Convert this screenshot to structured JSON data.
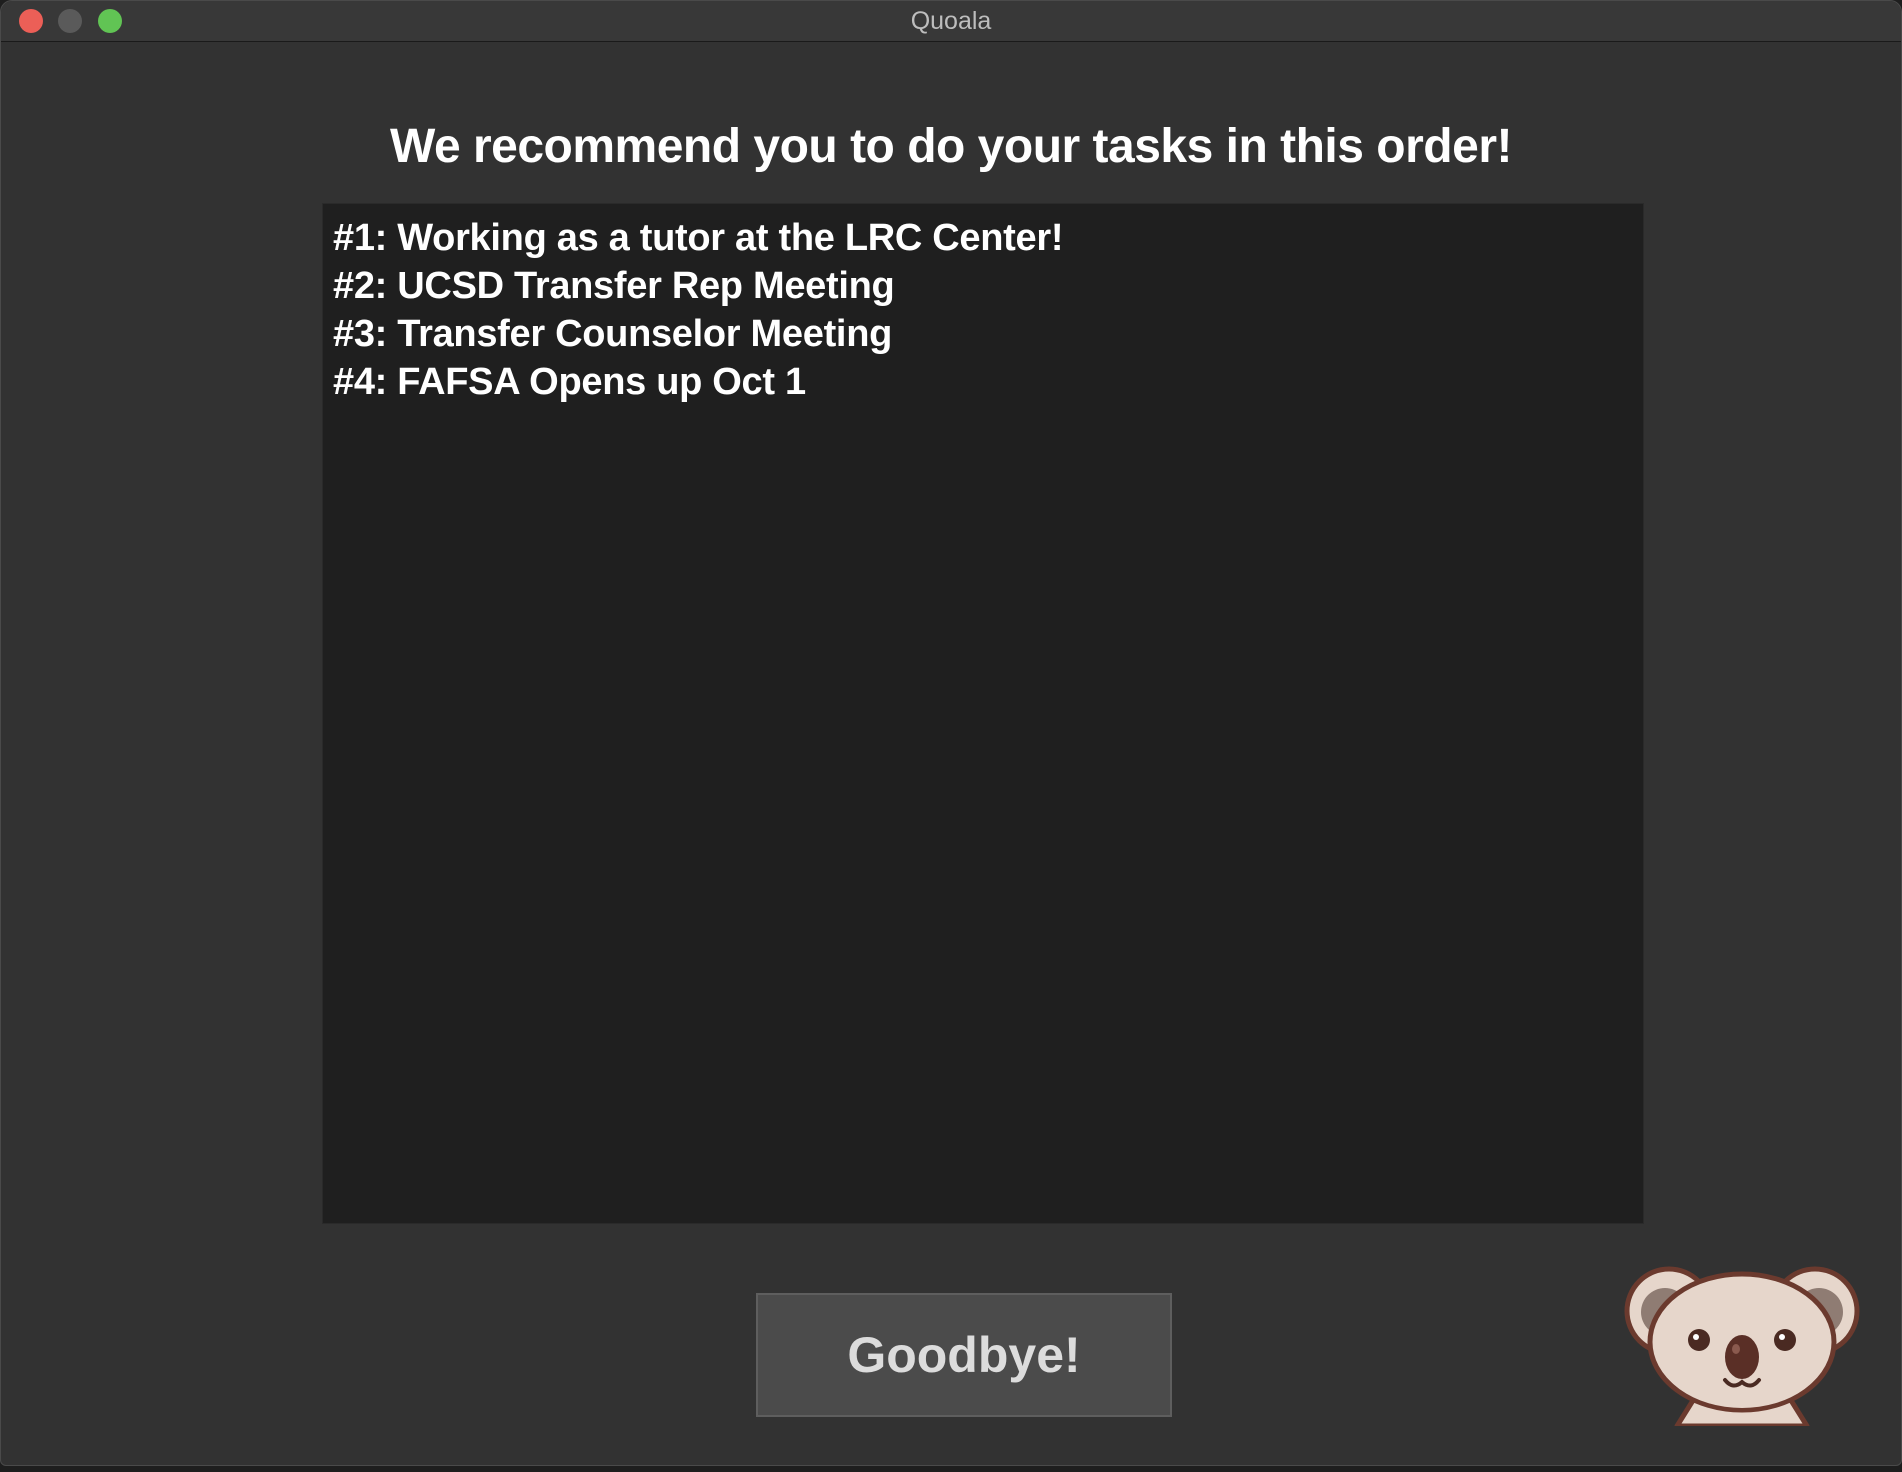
{
  "window": {
    "title": "Quoala"
  },
  "main": {
    "heading": "We recommend you to do your tasks in this order!",
    "tasks": [
      "#1: Working as a tutor at the LRC Center!",
      "#2: UCSD Transfer Rep Meeting",
      "#3: Transfer Counselor Meeting",
      "#4: FAFSA Opens up Oct 1"
    ],
    "goodbye_label": "Goodbye!"
  },
  "icons": {
    "mascot": "koala-icon",
    "close": "close-icon",
    "minimize": "minimize-icon",
    "zoom": "zoom-icon"
  },
  "colors": {
    "window_bg": "#323232",
    "panel_bg": "#1f1f1f",
    "button_bg": "#4b4b4b",
    "close": "#ec5f57",
    "minimize": "#5a5a5a",
    "zoom": "#61c454"
  }
}
